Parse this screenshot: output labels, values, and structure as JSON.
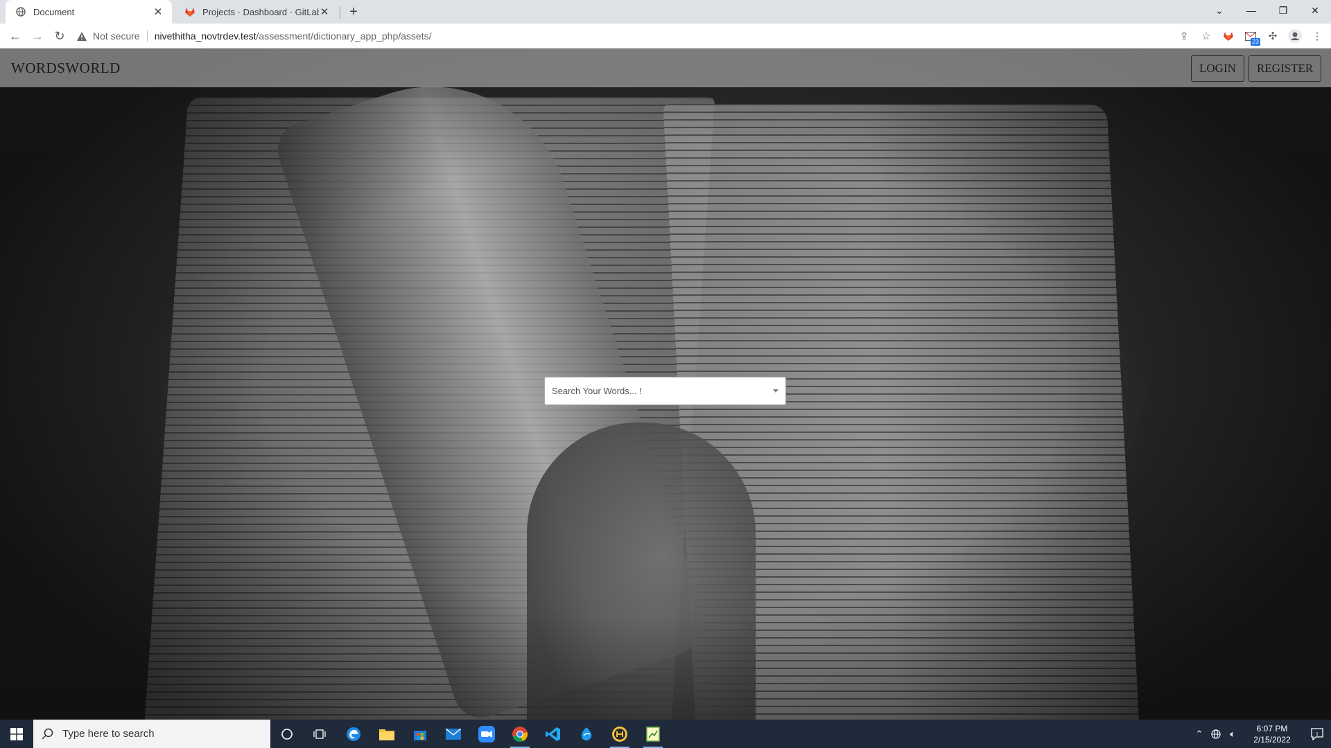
{
  "browser": {
    "tabs": [
      {
        "title": "Document",
        "active": true
      },
      {
        "title": "Projects · Dashboard · GitLab",
        "active": false
      }
    ],
    "address": {
      "security_label": "Not secure",
      "host": "nivethitha_novtrdev.test",
      "path": "/assessment/dictionary_app_php/assets/"
    },
    "extension_badge": "23"
  },
  "site": {
    "brand": "WORDSWORLD",
    "login_label": "LOGIN",
    "register_label": "REGISTER",
    "search": {
      "placeholder": "Search Your Words... !"
    }
  },
  "taskbar": {
    "search_placeholder": "Type here to search",
    "time": "6:07 PM",
    "date": "2/15/2022",
    "notification_count": "1"
  }
}
